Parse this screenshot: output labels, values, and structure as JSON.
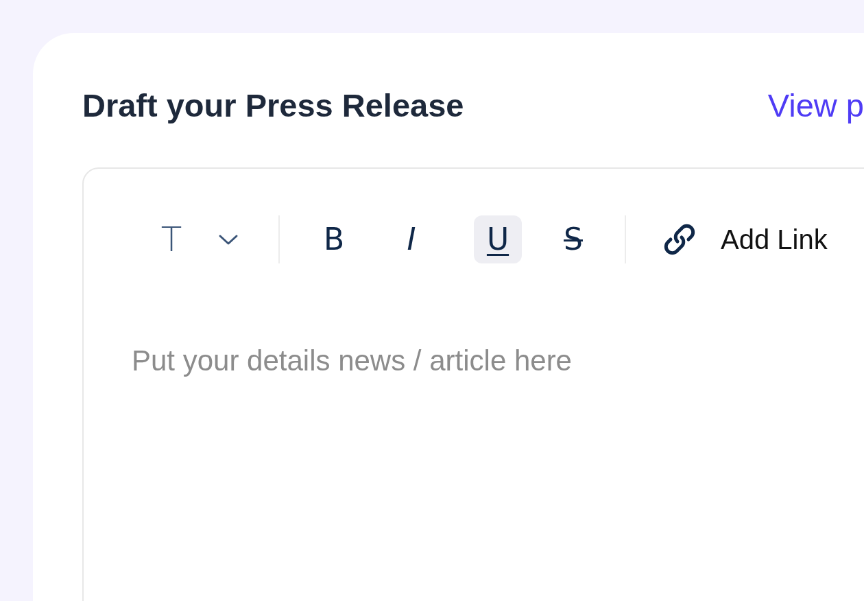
{
  "title": "Draft your Press Release",
  "view_link": "View p",
  "editor": {
    "text_style": {
      "label": "T"
    },
    "tools": [
      {
        "kind": "bold",
        "label": "B",
        "selected": false
      },
      {
        "kind": "italic",
        "label": "I",
        "selected": false
      },
      {
        "kind": "underline",
        "label": "U",
        "selected": true
      },
      {
        "kind": "strike",
        "label": "S",
        "selected": false
      }
    ],
    "add_link": "Add Link",
    "placeholder": "Put your details news / article here"
  }
}
